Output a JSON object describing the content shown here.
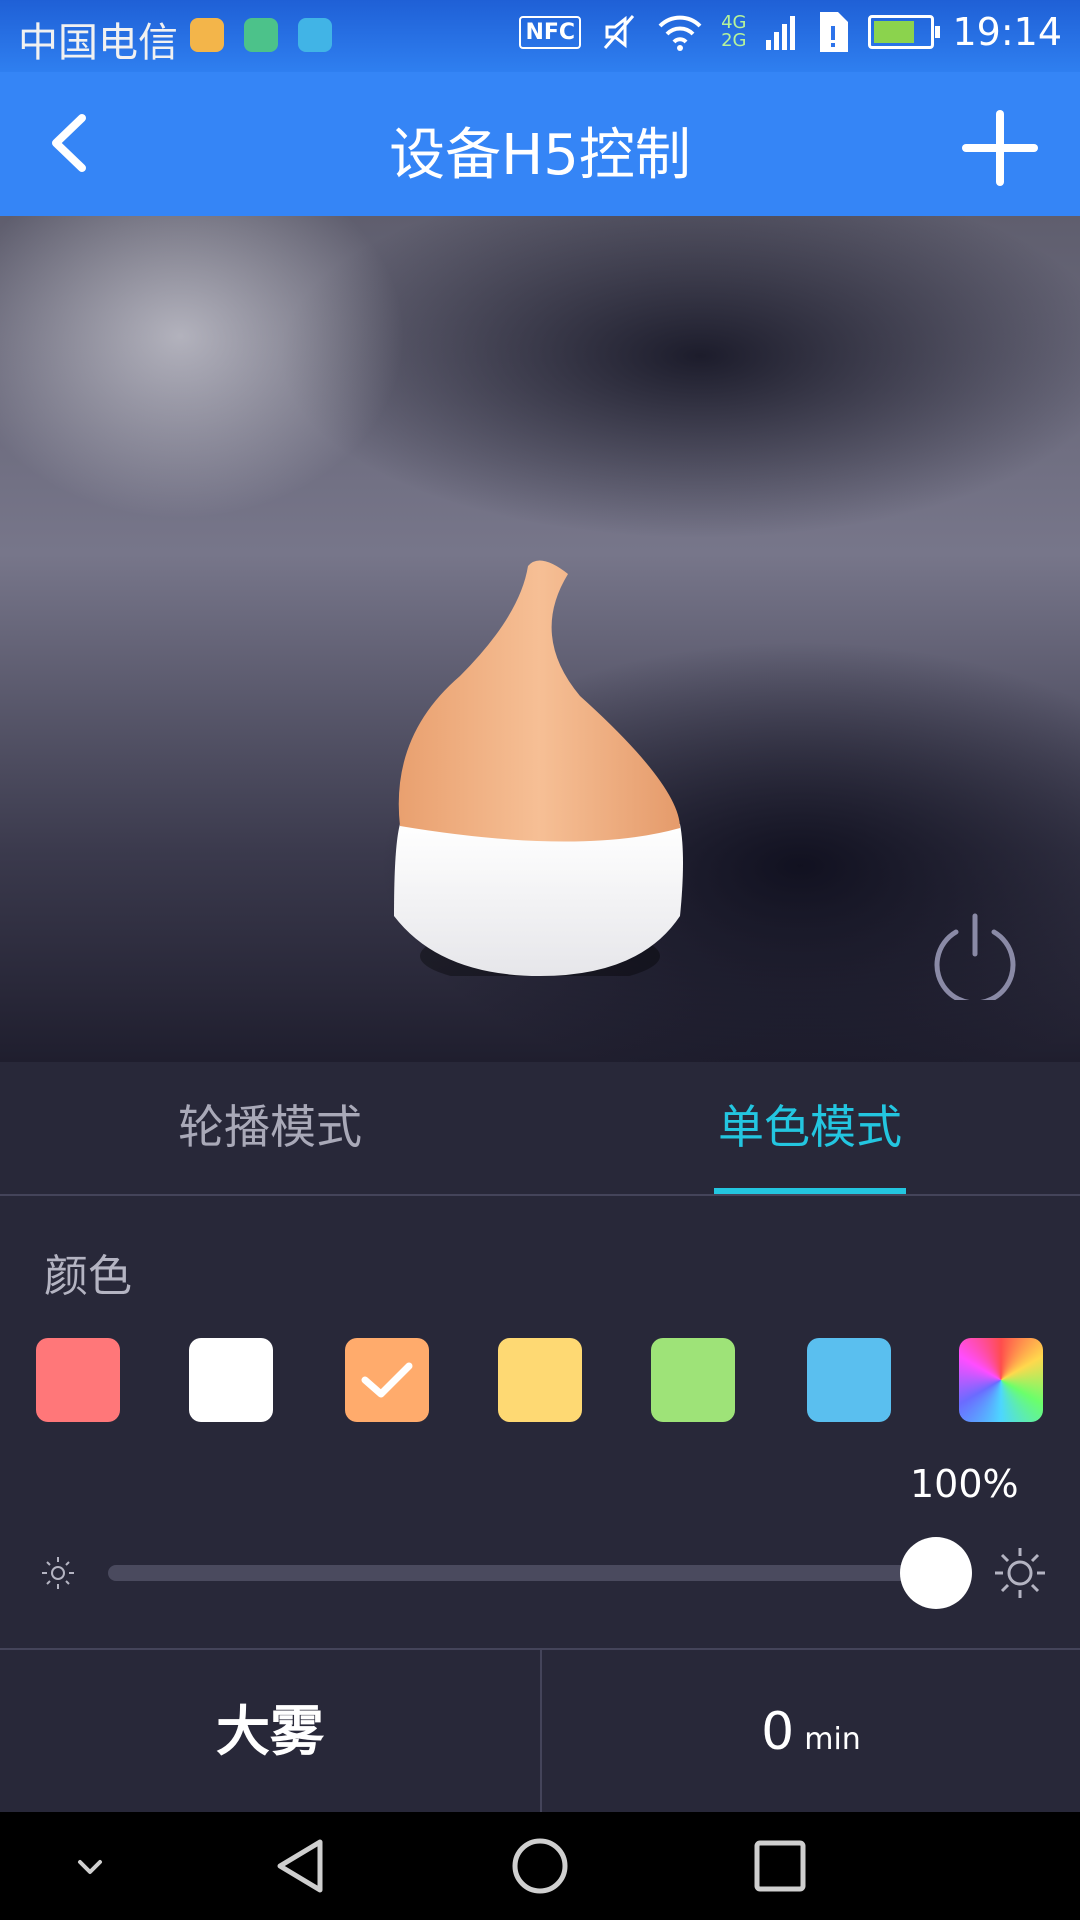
{
  "status_bar": {
    "carrier": "中国电信",
    "nfc": "NFC",
    "network_top": "4G",
    "network_bottom": "2G",
    "time": "19:14",
    "app_icon_colors": [
      "#f3b54a",
      "#4cc28a",
      "#41b4e6"
    ]
  },
  "app_bar": {
    "title": "设备H5控制",
    "back_icon": "chevron-left-icon",
    "add_icon": "plus-icon"
  },
  "hero": {
    "product": "diffuser-image",
    "power_icon": "power-icon",
    "diffuser_color": "#f2b78a"
  },
  "tabs": [
    {
      "label": "轮播模式",
      "active": false
    },
    {
      "label": "单色模式",
      "active": true
    }
  ],
  "color_section": {
    "label": "颜色",
    "swatches": [
      {
        "color": "#ff7779",
        "selected": false
      },
      {
        "color": "#ffffff",
        "selected": false
      },
      {
        "color": "#ffab6c",
        "selected": true
      },
      {
        "color": "#fed973",
        "selected": false
      },
      {
        "color": "#9ee378",
        "selected": false
      },
      {
        "color": "#5abfef",
        "selected": false
      },
      {
        "color": "rainbow",
        "selected": false
      }
    ]
  },
  "brightness": {
    "value_text": "100%",
    "value": 1.0
  },
  "bottom_controls": {
    "mist_label": "大雾",
    "timer_value": "0",
    "timer_unit": "min"
  },
  "colors": {
    "accent": "#23c6e0",
    "app_bar": "#3585f6",
    "panel": "#282839"
  }
}
